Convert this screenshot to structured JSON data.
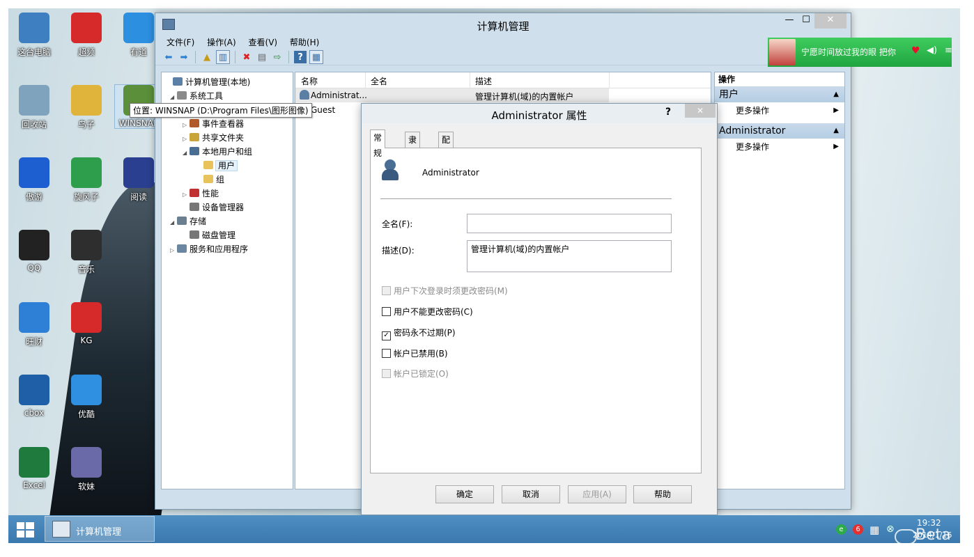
{
  "desktop_icons": [
    {
      "label": "这台电脑",
      "icon": "computer-icon",
      "color": "#3d7fc0"
    },
    {
      "label": "超频",
      "icon": "disc-icon",
      "color": "#d62a2a"
    },
    {
      "label": "有道",
      "icon": "youdao-icon",
      "color": "#2d8fe0"
    },
    {
      "label": "回收站",
      "icon": "recycle-bin-icon",
      "color": "#7fa2bd"
    },
    {
      "label": "鸟子",
      "icon": "bird-icon",
      "color": "#e0b43a"
    },
    {
      "label": "WINSNAP",
      "icon": "winsnap-icon",
      "color": "#5c8f3a"
    },
    {
      "label": "傲游",
      "icon": "maxthon-icon",
      "color": "#1d5fd0"
    },
    {
      "label": "旋风子",
      "icon": "whirlwind-icon",
      "color": "#2e9e4d"
    },
    {
      "label": "阅读",
      "icon": "book-icon",
      "color": "#2a3f8f"
    },
    {
      "label": "QQ",
      "icon": "penguin-icon",
      "color": "#222"
    },
    {
      "label": "音乐",
      "icon": "music-icon",
      "color": "#2e2e2e"
    },
    {
      "label": "旺财",
      "icon": "wangcai-icon",
      "color": "#2e7fd6"
    },
    {
      "label": "KG",
      "icon": "kg-icon",
      "color": "#d62a2a"
    },
    {
      "label": "cbox",
      "icon": "cbox-icon",
      "color": "#1f5fa8"
    },
    {
      "label": "优酷",
      "icon": "play-icon",
      "color": "#2f8fe0"
    },
    {
      "label": "Excel",
      "icon": "excel-icon",
      "color": "#1f7a3d"
    },
    {
      "label": "软妹",
      "icon": "app-icon",
      "color": "#6a6aa8"
    }
  ],
  "window": {
    "title": "计算机管理",
    "menu": [
      "文件(F)",
      "操作(A)",
      "查看(V)",
      "帮助(H)"
    ]
  },
  "tooltip": "位置: WINSNAP (D:\\Program Files\\图形图像)",
  "tree": [
    {
      "label": "计算机管理(本地)",
      "icon": "computer-management-icon",
      "level": 0,
      "expander": ""
    },
    {
      "label": "系统工具",
      "icon": "tools-icon",
      "level": 1,
      "expander": "◢"
    },
    {
      "label": "事件查看器",
      "icon": "event-viewer-icon",
      "level": 2,
      "expander": "▷"
    },
    {
      "label": "共享文件夹",
      "icon": "shared-folder-icon",
      "level": 2,
      "expander": "▷"
    },
    {
      "label": "本地用户和组",
      "icon": "users-groups-icon",
      "level": 2,
      "expander": "◢"
    },
    {
      "label": "用户",
      "icon": "folder-icon",
      "level": 3,
      "expander": ""
    },
    {
      "label": "组",
      "icon": "folder-icon",
      "level": 3,
      "expander": ""
    },
    {
      "label": "性能",
      "icon": "performance-icon",
      "level": 2,
      "expander": "▷"
    },
    {
      "label": "设备管理器",
      "icon": "device-manager-icon",
      "level": 2,
      "expander": ""
    },
    {
      "label": "存储",
      "icon": "storage-icon",
      "level": 1,
      "expander": "◢"
    },
    {
      "label": "磁盘管理",
      "icon": "disk-icon",
      "level": 2,
      "expander": ""
    },
    {
      "label": "服务和应用程序",
      "icon": "services-icon",
      "level": 1,
      "expander": "▷"
    }
  ],
  "list": {
    "columns": [
      "名称",
      "全名",
      "描述"
    ],
    "rows": [
      {
        "name": "Administrat...",
        "fullname": "",
        "desc": "管理计算机(域)的内置帐户"
      },
      {
        "name": "Guest",
        "fullname": "",
        "desc": ""
      }
    ]
  },
  "actions": {
    "header": "操作",
    "groups": [
      {
        "title": "用户",
        "item": "更多操作"
      },
      {
        "title": "Administrator",
        "item": "更多操作"
      }
    ]
  },
  "dialog": {
    "title": "Administrator 属性",
    "help_glyph": "?",
    "close_glyph": "✕",
    "tabs": [
      "常规",
      "隶属于",
      "配置文件"
    ],
    "user_name": "Administrator",
    "fullname_label": "全名(F):",
    "fullname_value": "",
    "desc_label": "描述(D):",
    "desc_value": "管理计算机(域)的内置帐户",
    "checkboxes": [
      {
        "label": "用户下次登录时须更改密码(M)",
        "checked": false,
        "disabled": true
      },
      {
        "label": "用户不能更改密码(C)",
        "checked": false,
        "disabled": false
      },
      {
        "label": "密码永不过期(P)",
        "checked": true,
        "disabled": false
      },
      {
        "label": "帐户已禁用(B)",
        "checked": false,
        "disabled": false
      },
      {
        "label": "帐户已锁定(O)",
        "checked": false,
        "disabled": true
      }
    ],
    "buttons": [
      "确定",
      "取消",
      "应用(A)",
      "帮助"
    ]
  },
  "music_player": {
    "song": "宁愿时间放过我的眼 把你"
  },
  "taskbar": {
    "task": "计算机管理",
    "time": "19:32",
    "date": "2014/1/16",
    "watermark": "Beta"
  }
}
